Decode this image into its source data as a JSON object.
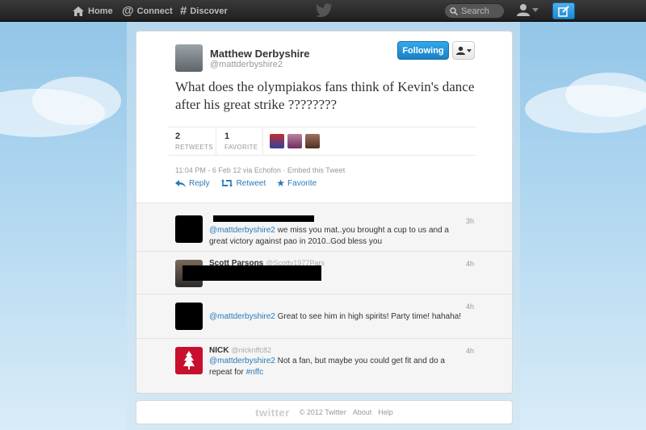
{
  "nav": {
    "home": "Home",
    "connect": "Connect",
    "discover": "Discover",
    "search_placeholder": "Search"
  },
  "tweet": {
    "fullname": "Matthew Derbyshire",
    "screenname": "@mattderbyshire2",
    "follow_label": "Following",
    "text": "What does the olympiakos fans think of Kevin's dance after his great strike ????????",
    "retweets": "2",
    "retweets_label": "RETWEETS",
    "favorites": "1",
    "favorites_label": "FAVORITE",
    "meta": "11:04 PM - 6 Feb 12 via Echofon · Embed this Tweet",
    "reply_label": "Reply",
    "retweet_label": "Retweet",
    "favorite_label": "Favorite"
  },
  "replies": [
    {
      "mention": "@mattderbyshire2",
      "text": " we miss you mat..you brought a cup to us and a great victory against pao in 2010..God bless you",
      "time": "3h"
    },
    {
      "name": "Scott Parsons",
      "screenname": "@Scotty1977Pars",
      "time": "4h"
    },
    {
      "mention": "@mattderbyshire2",
      "text": " Great to see him in high spirits! Party time! hahaha!",
      "time": "4h"
    },
    {
      "name": "NICK",
      "screenname": "@nicknffc82",
      "mention": "@mattderbyshire2",
      "text": " Not a fan, but maybe you could get fit and do a repeat for ",
      "hashtag": "#nffc",
      "time": "4h"
    }
  ],
  "footer": {
    "logo": "twitter",
    "copyright": "© 2012 Twitter",
    "about": "About",
    "help": "Help"
  },
  "colors": {
    "link": "#2a7ab8",
    "follow_button": "#1b7fc4",
    "topbar": "#2b2b2b"
  }
}
